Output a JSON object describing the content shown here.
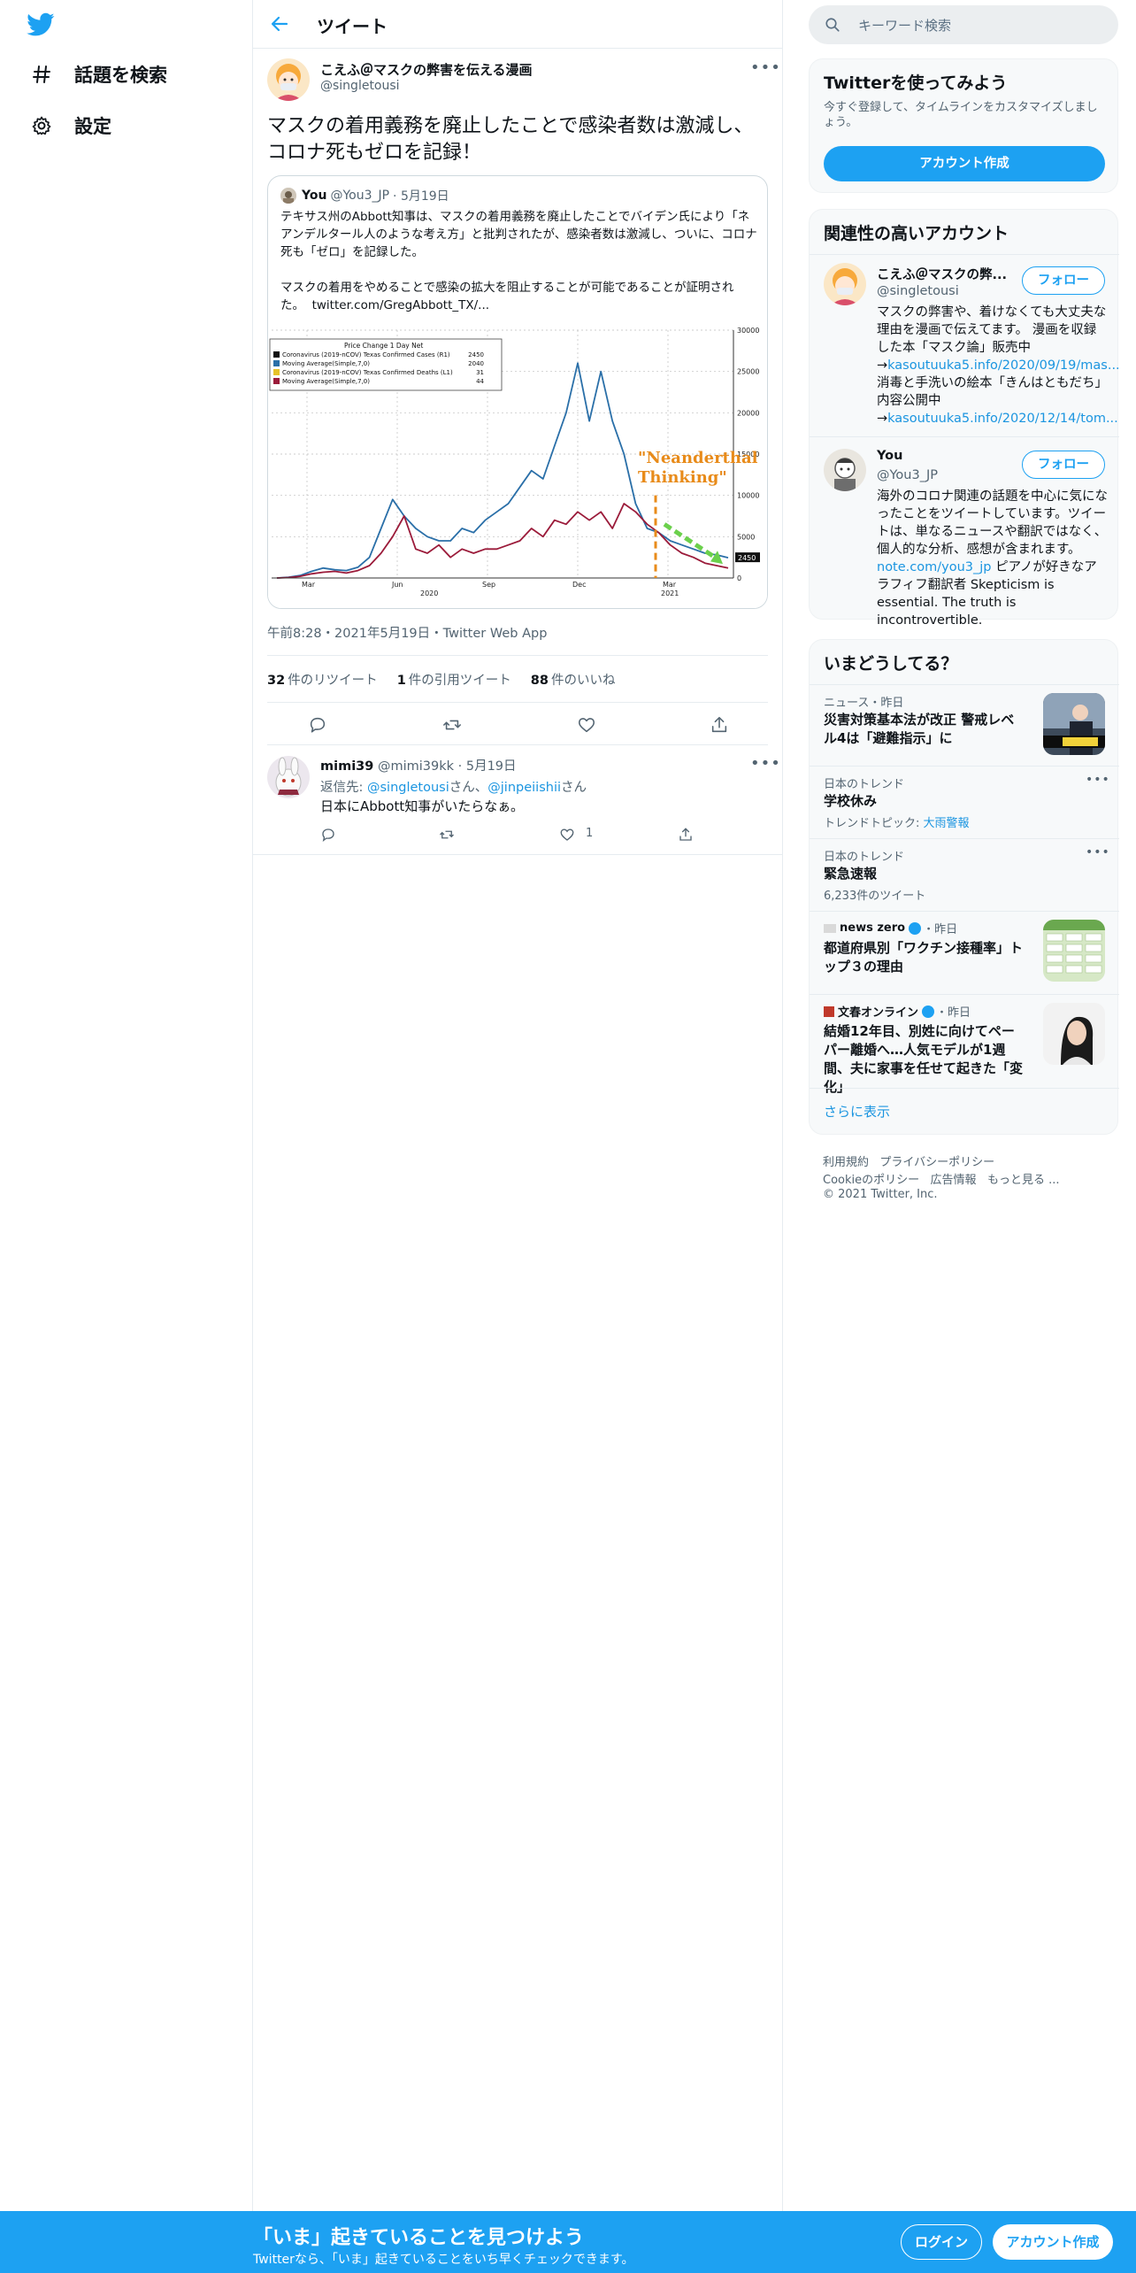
{
  "nav": {
    "explore_label": "話題を検索",
    "settings_label": "設定"
  },
  "header": {
    "title": "ツイート"
  },
  "tweet": {
    "author_name": "こえふ＠マスクの弊害を伝える漫画",
    "author_handle": "@singletousi",
    "text": "マスクの着用義務を廃止したことで感染者数は激減し、コロナ死もゼロを記録！",
    "timestamp": "午前8:28・2021年5月19日・Twitter Web App",
    "retweets_count": "32",
    "retweets_label": "件のリツイート",
    "quotes_count": "1",
    "quotes_label": "件の引用ツイート",
    "likes_count": "88",
    "likes_label": "件のいいね"
  },
  "quote": {
    "name": "You",
    "handle": "@You3_JP",
    "date": "· 5月19日",
    "text_p1": "テキサス州のAbbott知事は、マスクの着用義務を廃止したことでバイデン氏により「ネアンデルタール人のような考え方」と批判されたが、感染者数は激減し、ついに、コロナ死も「ゼロ」を記録した。",
    "text_p2": "マスクの着用をやめることで感染の拡大を阻止することが可能であることが証明された。",
    "link": "twitter.com/GregAbbott_TX/..."
  },
  "chart_data": {
    "type": "line",
    "title": "Price Change 1 Day Net",
    "annotation": "\"Neanderthal Thinking\"",
    "x_ticks": [
      "Mar",
      "Jun",
      "Sep",
      "Dec",
      "Mar"
    ],
    "x_years": [
      "2020",
      "2021"
    ],
    "y_ticks": [
      0,
      5000,
      10000,
      15000,
      20000,
      25000,
      30000
    ],
    "ylim": [
      0,
      30000
    ],
    "legend": [
      {
        "name": "Coronavirus (2019-nCOV) Texas Confirmed Cases (R1)",
        "value": "2450",
        "color": "#111111"
      },
      {
        "name": "Moving Average(Simple,7,0)",
        "value": "2040",
        "color": "#2a6fa8"
      },
      {
        "name": "Coronavirus (2019-nCOV) Texas Confirmed Deaths (L1)",
        "value": "31",
        "color": "#e6c22a"
      },
      {
        "name": "Moving Average(Simple,7,0)",
        "value": "44",
        "color": "#9b1b3a"
      }
    ],
    "last_value_label": "2450",
    "series": [
      {
        "name": "Moving Average(Simple,7,0)",
        "color": "#2a6fa8",
        "values": [
          0,
          100,
          300,
          800,
          1200,
          1000,
          900,
          1300,
          2500,
          6000,
          9500,
          7500,
          6000,
          5000,
          4500,
          4500,
          6000,
          5500,
          7000,
          8000,
          9000,
          11000,
          13000,
          12000,
          16000,
          20000,
          26000,
          19000,
          25000,
          19000,
          15000,
          9000,
          6000,
          5500,
          4500,
          4000,
          3500,
          3000,
          2800,
          2450
        ]
      },
      {
        "name": "Moving Average(Simple,7,0)",
        "color": "#9b1b3a",
        "values": [
          0,
          50,
          200,
          500,
          700,
          800,
          600,
          900,
          1500,
          3000,
          5000,
          7500,
          3500,
          3000,
          4000,
          2500,
          3500,
          3000,
          3500,
          3500,
          4000,
          4500,
          6000,
          5000,
          7000,
          6500,
          8000,
          7000,
          8000,
          6000,
          9000,
          8000,
          6500,
          5500,
          4000,
          3000,
          2500,
          1800,
          1500,
          1200
        ]
      }
    ]
  },
  "reply": {
    "name": "mimi39",
    "handle": "@mimi39kk",
    "date": "· 5月19日",
    "to_prefix": "返信先: ",
    "to_user1": "@singletousi",
    "to_san": "さん、",
    "to_user2": "@jinpeiishii",
    "to_san2": "さん",
    "text": "日本にAbbott知事がいたらなぁ。",
    "like_count": "1"
  },
  "search": {
    "placeholder": "キーワード検索"
  },
  "signup_card": {
    "title": "Twitterを使ってみよう",
    "subtitle": "今すぐ登録して、タイムラインをカスタマイズしましょう。",
    "button": "アカウント作成"
  },
  "related": {
    "title": "関連性の高いアカウント",
    "follow_label": "フォロー",
    "accounts": [
      {
        "name": "こえふ＠マスクの弊...",
        "handle": "@singletousi",
        "bio1": "マスクの弊害や、着けなくても大丈夫な理由を漫画で伝えてます。 漫画を収録した本「マスク論」販売中→",
        "link1": "kasoutuuka5.info/2020/09/19/mas...",
        "bio2": "消毒と手洗いの絵本「きんはともだち」内容公開中→",
        "link2": "kasoutuuka5.info/2020/12/14/tom..."
      },
      {
        "name": "You",
        "handle": "@You3_JP",
        "bio1": "海外のコロナ関連の話題を中心に気になったことをツイートしています。ツイートは、単なるニュースや翻訳ではなく、個人的な分析、感想が含まれます。",
        "link1": "note.com/you3_jp",
        "bio2": "ピアノが好きなアラフィフ翻訳者 Skepticism is essential. The truth is incontrovertible."
      }
    ]
  },
  "trends": {
    "title": "いまどうしてる？",
    "items": [
      {
        "meta": "ニュース・昨日",
        "title": "災害対策基本法が改正 警戒レベル4は「避難指示」に"
      },
      {
        "meta": "日本のトレンド",
        "title": "学校休み",
        "sub_prefix": "トレンドトピック: ",
        "sub_link": "大雨警報"
      },
      {
        "meta": "日本のトレンド",
        "title": "緊急速報",
        "sub": "6,233件のツイート"
      },
      {
        "meta_source": "news zero",
        "meta_time": "・昨日",
        "title": "都道府県別「ワクチン接種率」トップ３の理由"
      },
      {
        "meta_source": "文春オンライン",
        "meta_time": "・昨日",
        "title": "結婚12年目、別姓に向けてペーパー離婚へ…人気モデルが1週間、夫に家事を任せて起きた「変化」"
      }
    ],
    "show_more": "さらに表示"
  },
  "footer": {
    "terms": "利用規約",
    "privacy": "プライバシーポリシー",
    "cookie": "Cookieのポリシー",
    "ads": "広告情報",
    "more": "もっと見る ...",
    "copyright": "© 2021 Twitter, Inc."
  },
  "bottom_bar": {
    "title": "「いま」起きていることを見つけよう",
    "subtitle": "Twitterなら、「いま」起きていることをいち早くチェックできます。",
    "login": "ログイン",
    "signup": "アカウント作成"
  },
  "colors": {
    "accent": "#1da1f2",
    "link": "#1b95e0"
  }
}
